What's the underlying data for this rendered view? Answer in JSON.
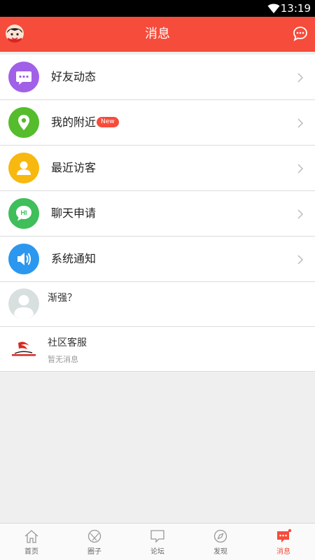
{
  "status_bar": {
    "time": "13:19",
    "icons": [
      "wifi-icon"
    ]
  },
  "header": {
    "title": "消息",
    "left_icon": "user-avatar",
    "right_icon": "chat-bubble-icon"
  },
  "menu": [
    {
      "label": "好友动态",
      "icon": "message-icon",
      "color": "#a160e8"
    },
    {
      "label": "我的附近",
      "icon": "location-pin-icon",
      "color": "#55bc2c",
      "badge": "New"
    },
    {
      "label": "最近访客",
      "icon": "person-icon",
      "color": "#f7b80f"
    },
    {
      "label": "聊天申请",
      "icon": "hi-chat-icon",
      "color": "#3fbe5a"
    },
    {
      "label": "系统通知",
      "icon": "speaker-icon",
      "color": "#2b97ef"
    }
  ],
  "messages": [
    {
      "name": "渐强？",
      "preview": "",
      "avatar": "default-avatar"
    },
    {
      "name": "社区客服",
      "preview": "暂无消息",
      "avatar": "community-logo"
    }
  ],
  "tabs": [
    {
      "label": "首页",
      "icon": "home-icon",
      "active": false
    },
    {
      "label": "圈子",
      "icon": "circle-icon",
      "active": false
    },
    {
      "label": "论坛",
      "icon": "forum-icon",
      "active": false
    },
    {
      "label": "发现",
      "icon": "compass-icon",
      "active": false
    },
    {
      "label": "消息",
      "icon": "message-icon",
      "active": true
    }
  ],
  "colors": {
    "accent": "#f64c3b",
    "background": "#efefef"
  }
}
